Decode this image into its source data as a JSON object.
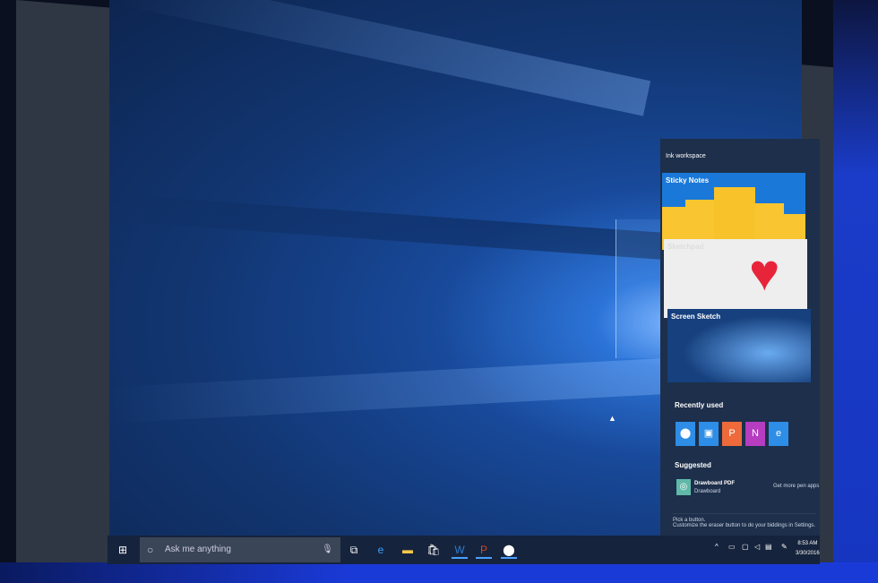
{
  "panel": {
    "title": "Ink workspace",
    "tiles": [
      {
        "label": "Sticky Notes"
      },
      {
        "label": "Sketchpad"
      },
      {
        "label": "Screen Sketch"
      }
    ],
    "recently_used_label": "Recently used",
    "recent_apps": [
      {
        "name": "maps-app",
        "glyph": "⬤",
        "color": "#2e8de6"
      },
      {
        "name": "outlook-app",
        "glyph": "▣",
        "color": "#2e8de6"
      },
      {
        "name": "powerpoint-app",
        "glyph": "P",
        "color": "#ee6a3a"
      },
      {
        "name": "onenote-app",
        "glyph": "N",
        "color": "#b63cc0"
      },
      {
        "name": "edge-app",
        "glyph": "e",
        "color": "#2e8de6"
      }
    ],
    "suggested_label": "Suggested",
    "suggested_app": {
      "title": "Drawboard PDF",
      "publisher": "Drawboard"
    },
    "get_more_link": "Get more pen apps",
    "footer_line1": "Pick a button.",
    "footer_line2": "Customize the eraser button to do your biddings in Settings."
  },
  "taskbar": {
    "search_placeholder": "Ask me anything",
    "time": "8:53 AM",
    "date": "3/30/2016"
  }
}
